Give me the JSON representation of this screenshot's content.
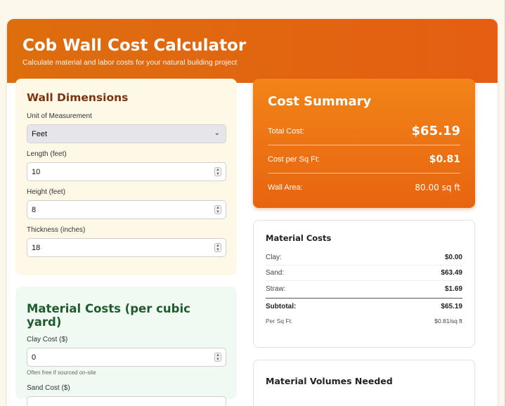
{
  "header": {
    "title": "Cob Wall Cost Calculator",
    "subtitle": "Calculate material and labor costs for your natural building project"
  },
  "wall_dimensions": {
    "title": "Wall Dimensions",
    "unit_label": "Unit of Measurement",
    "unit_value": "Feet",
    "length_label": "Length (feet)",
    "length_value": "10",
    "height_label": "Height (feet)",
    "height_value": "8",
    "thickness_label": "Thickness (inches)",
    "thickness_value": "18"
  },
  "material_inputs": {
    "title": "Material Costs (per cubic yard)",
    "clay_label": "Clay Cost ($)",
    "clay_value": "0",
    "clay_hint": "Often free if sourced on-site",
    "sand_label": "Sand Cost ($)"
  },
  "summary": {
    "title": "Cost Summary",
    "total_label": "Total Cost:",
    "total_value": "$65.19",
    "per_sqft_label": "Cost per Sq Ft:",
    "per_sqft_value": "$0.81",
    "area_label": "Wall Area:",
    "area_value": "80.00 sq ft"
  },
  "material_costs": {
    "title": "Material Costs",
    "rows": [
      {
        "label": "Clay:",
        "value": "$0.00"
      },
      {
        "label": "Sand:",
        "value": "$63.49"
      },
      {
        "label": "Straw:",
        "value": "$1.69"
      }
    ],
    "subtotal_label": "Subtotal:",
    "subtotal_value": "$65.19",
    "per_sqft_label": "Per Sq Ft:",
    "per_sqft_value": "$0.81/sq ft"
  },
  "volumes": {
    "title": "Material Volumes Needed"
  },
  "colors": {
    "header_accent": "#e0640f",
    "summary_accent": "#f07a16",
    "dims_panel": "#fef9e7",
    "materials_panel": "#f0faf3"
  }
}
